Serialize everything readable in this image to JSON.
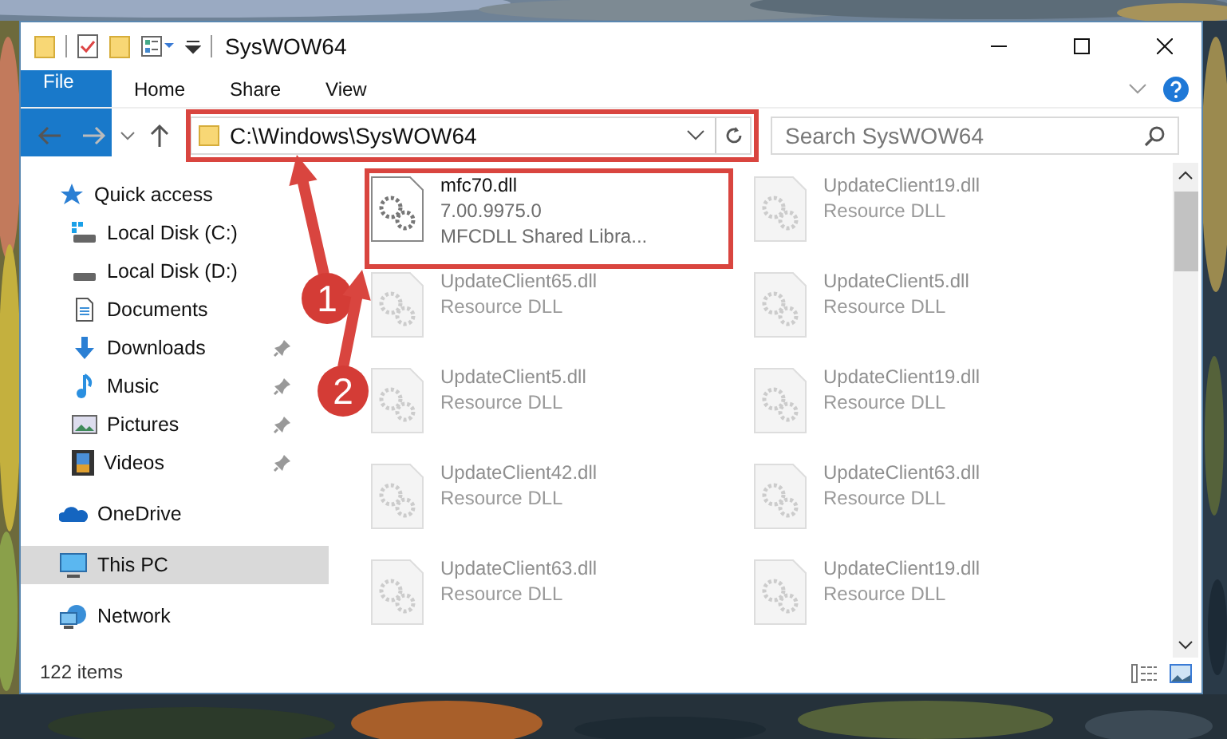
{
  "window": {
    "title": "SysWOW64"
  },
  "ribbon_tabs": [
    {
      "label": "File",
      "kind": "file"
    },
    {
      "label": "Home",
      "kind": "tab"
    },
    {
      "label": "Share",
      "kind": "tab"
    },
    {
      "label": "View",
      "kind": "tab"
    }
  ],
  "address_bar": {
    "path": "C:\\Windows\\SysWOW64"
  },
  "search": {
    "placeholder": "Search SysWOW64"
  },
  "sidebar": {
    "items": [
      {
        "label": "Quick access",
        "kind": "star",
        "selected": false,
        "children": [
          {
            "label": "Local Disk (C:)",
            "kind": "drive-c",
            "pinned": false,
            "selected": false
          },
          {
            "label": "Local Disk (D:)",
            "kind": "drive",
            "pinned": false,
            "selected": false
          },
          {
            "label": "Documents",
            "kind": "documents",
            "pinned": false,
            "selected": false
          },
          {
            "label": "Downloads",
            "kind": "downloads",
            "pinned": true,
            "selected": false
          },
          {
            "label": "Music",
            "kind": "music",
            "pinned": true,
            "selected": false
          },
          {
            "label": "Pictures",
            "kind": "pictures",
            "pinned": true,
            "selected": false
          },
          {
            "label": "Videos",
            "kind": "videos",
            "pinned": true,
            "selected": false
          }
        ]
      },
      {
        "label": "OneDrive",
        "kind": "cloud",
        "selected": false
      },
      {
        "label": "This PC",
        "kind": "pc",
        "selected": true
      },
      {
        "label": "Network",
        "kind": "network",
        "selected": false
      }
    ]
  },
  "files": [
    {
      "name": "mfc70.dll",
      "version": "7.00.9975.0",
      "description": "MFCDLL Shared Libra...",
      "faded": false
    },
    {
      "name": "UpdateClient65.dll",
      "description": "Resource DLL",
      "faded": true
    },
    {
      "name": "UpdateClient5.dll",
      "description": "Resource DLL",
      "faded": true
    },
    {
      "name": "UpdateClient42.dll",
      "description": "Resource DLL",
      "faded": true
    },
    {
      "name": "UpdateClient63.dll",
      "description": "Resource DLL",
      "faded": true
    },
    {
      "name": "UpdateClient19.dll",
      "description": "Resource DLL",
      "faded": true
    },
    {
      "name": "UpdateClient5.dll",
      "description": "Resource DLL",
      "faded": true
    },
    {
      "name": "UpdateClient19.dll",
      "description": "Resource DLL",
      "faded": true
    },
    {
      "name": "UpdateClient63.dll",
      "description": "Resource DLL",
      "faded": true
    },
    {
      "name": "UpdateClient19.dll",
      "description": "Resource DLL",
      "faded": true
    }
  ],
  "status_bar": {
    "item_count": "122 items"
  },
  "annotations": [
    {
      "number": "1"
    },
    {
      "number": "2"
    }
  ]
}
